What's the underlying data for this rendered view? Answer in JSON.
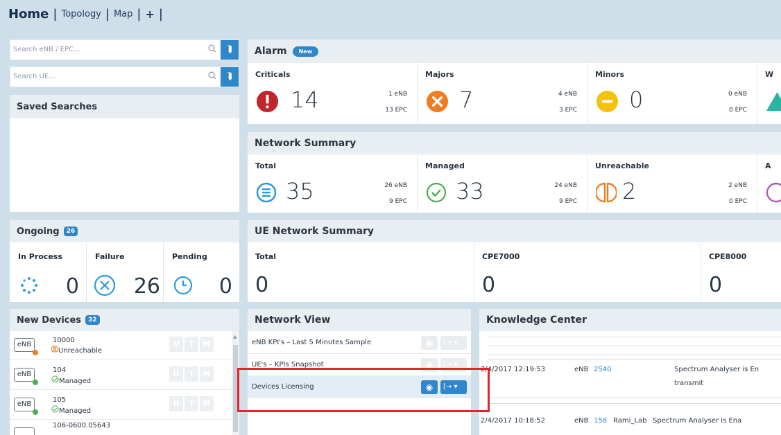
{
  "topnav": {
    "home": "Home",
    "tabs": [
      "Topology",
      "Map"
    ],
    "add": "+"
  },
  "search": {
    "enb_placeholder": "Search eNB / EPC...",
    "ue_placeholder": "Search UE..."
  },
  "saved_searches": {
    "title": "Saved Searches"
  },
  "alarm": {
    "title": "Alarm",
    "badge": "New",
    "cells": [
      {
        "label": "Criticals",
        "value": "14",
        "enb": "1 eNB",
        "epc": "13 EPC",
        "icon": "exclamation-icon",
        "color": "#c0272d"
      },
      {
        "label": "Majors",
        "value": "7",
        "enb": "4 eNB",
        "epc": "3 EPC",
        "icon": "x-icon",
        "color": "#ef7d22"
      },
      {
        "label": "Minors",
        "value": "0",
        "enb": "0 eNB",
        "epc": "0 EPC",
        "icon": "minus-icon",
        "color": "#f4c20d"
      },
      {
        "label": "W",
        "value": "",
        "enb": "",
        "epc": "",
        "icon": "warning-icon",
        "color": "#2bb3a3"
      }
    ]
  },
  "network_summary": {
    "title": "Network Summary",
    "cells": [
      {
        "label": "Total",
        "value": "35",
        "enb": "26 eNB",
        "epc": "9 EPC",
        "icon": "list-icon",
        "color": "#2f9ad6"
      },
      {
        "label": "Managed",
        "value": "33",
        "enb": "24 eNB",
        "epc": "9 EPC",
        "icon": "check-icon",
        "color": "#4caf50"
      },
      {
        "label": "Unreachable",
        "value": "2",
        "enb": "2 eNB",
        "epc": "0 EPC",
        "icon": "unreachable-icon",
        "color": "#ef7d22"
      },
      {
        "label": "A",
        "value": "",
        "enb": "",
        "epc": "",
        "icon": "circle-icon",
        "color": "#b058b6"
      }
    ]
  },
  "ongoing": {
    "title": "Ongoing",
    "badge": "26",
    "cells": [
      {
        "label": "In Process",
        "value": "0",
        "icon": "spinner-icon"
      },
      {
        "label": "Failure",
        "value": "26",
        "icon": "failure-icon"
      },
      {
        "label": "Pending",
        "value": "0",
        "icon": "clock-icon"
      }
    ]
  },
  "ue_summary": {
    "title": "UE Network Summary",
    "cells": [
      {
        "label": "Total",
        "value": "0"
      },
      {
        "label": "CPE7000",
        "value": "0"
      },
      {
        "label": "CPE8000",
        "value": "0"
      }
    ]
  },
  "new_devices": {
    "title": "New Devices",
    "badge": "32",
    "items": [
      {
        "type": "eNB",
        "name": "10000",
        "status": "Unreachable",
        "dot": "#ef7d22"
      },
      {
        "type": "eNB",
        "name": "104",
        "status": "Managed",
        "dot": "#4caf50"
      },
      {
        "type": "eNB",
        "name": "105",
        "status": "Managed",
        "dot": "#4caf50"
      },
      {
        "type": "eNB",
        "name": "106-0600.05643",
        "status": "",
        "dot": "#4caf50"
      }
    ],
    "buttons": [
      "D",
      "T",
      "M"
    ]
  },
  "network_view": {
    "title": "Network View",
    "items": [
      {
        "label": "eNB KPI's – Last 5 Minutes Sample",
        "active": false
      },
      {
        "label": "UE's – KPIs Snapshot",
        "active": false
      },
      {
        "label": "Devices Licensing",
        "active": true
      }
    ]
  },
  "knowledge_center": {
    "title": "Knowledge Center",
    "rows": [
      {
        "date": "2/4/2017 12:19:53",
        "type": "eNB",
        "id": "2540",
        "user": "",
        "desc": "Spectrum Analyser is En",
        "desc2": "transmit"
      },
      {
        "date": "2/4/2017 10:18:52",
        "type": "eNB",
        "id": "158",
        "user": "Rami_Lab",
        "desc": "Spectrum Analyser is Ena",
        "desc2": ""
      }
    ]
  },
  "colors": {
    "accent": "#2f86c8",
    "highlight_box": "#e0252b"
  }
}
